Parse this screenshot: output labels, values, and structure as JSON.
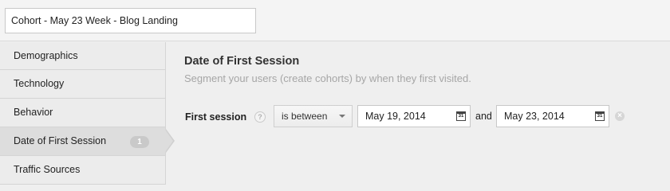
{
  "segment_name": "Cohort - May 23 Week - Blog Landing",
  "sidebar": {
    "items": [
      {
        "label": "Demographics"
      },
      {
        "label": "Technology"
      },
      {
        "label": "Behavior"
      },
      {
        "label": "Date of First Session",
        "badge": "1"
      },
      {
        "label": "Traffic Sources"
      }
    ]
  },
  "main": {
    "title": "Date of First Session",
    "subtitle": "Segment your users (create cohorts) by when they first visited.",
    "filter": {
      "label": "First session",
      "help_icon": "?",
      "operator": "is between",
      "start_date": "May 19, 2014",
      "connector": "and",
      "end_date": "May 23, 2014",
      "calendar_glyph": "31",
      "remove_glyph": "×"
    }
  },
  "colors": {
    "background": "#efefef",
    "sidebar_active": "#dddddd",
    "subtitle_gray": "#a6a6a6"
  }
}
